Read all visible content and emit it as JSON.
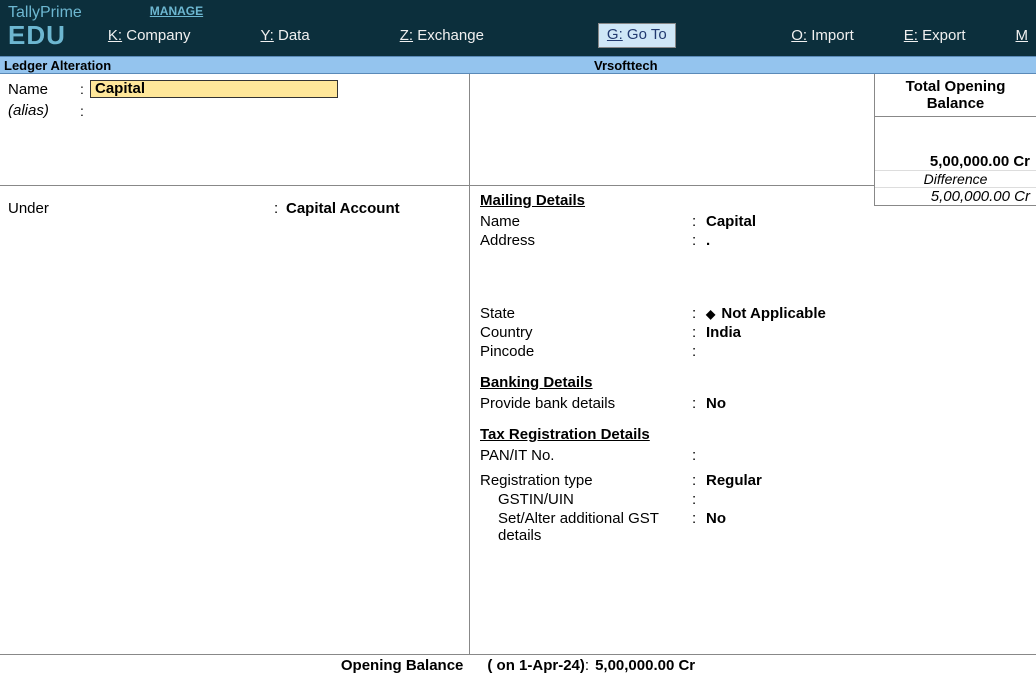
{
  "app": {
    "prime": "TallyPrime",
    "edu": "EDU",
    "manage": "MANAGE"
  },
  "menu": {
    "company_k": "K:",
    "company_t": " Company",
    "data_k": "Y:",
    "data_t": " Data",
    "exchange_k": "Z:",
    "exchange_t": " Exchange",
    "goto_k": "G:",
    "goto_t": " Go To",
    "import_k": "O:",
    "import_t": " Import",
    "export_k": "E:",
    "export_t": " Export",
    "more_k": "M"
  },
  "context": {
    "mode": "Ledger Alteration",
    "company": "Vrsofttech"
  },
  "ledger": {
    "name_label": "Name",
    "name_value": "Capital",
    "alias_label": "(alias)",
    "under_label": "Under",
    "under_value": "Capital Account"
  },
  "opening": {
    "title": "Total Opening Balance",
    "value": "5,00,000.00 Cr",
    "diff_label": "Difference",
    "diff_value": "5,00,000.00 Cr"
  },
  "mailing": {
    "title": "Mailing Details",
    "name_l": "Name",
    "name_v": "Capital",
    "address_l": "Address",
    "address_v": ".",
    "state_l": "State",
    "state_v": "Not Applicable",
    "country_l": "Country",
    "country_v": "India",
    "pincode_l": "Pincode",
    "pincode_v": ""
  },
  "banking": {
    "title": "Banking Details",
    "provide_l": "Provide bank details",
    "provide_v": "No"
  },
  "tax": {
    "title": "Tax Registration Details",
    "pan_l": "PAN/IT No.",
    "pan_v": "",
    "regtype_l": "Registration type",
    "regtype_v": "Regular",
    "gstin_l": "GSTIN/UIN",
    "gstin_v": "",
    "setalter_l": "Set/Alter additional GST details",
    "setalter_v": "No"
  },
  "footer": {
    "label": "Opening Balance",
    "date": "( on 1-Apr-24)",
    "sep": " : ",
    "value": "5,00,000.00 Cr"
  }
}
